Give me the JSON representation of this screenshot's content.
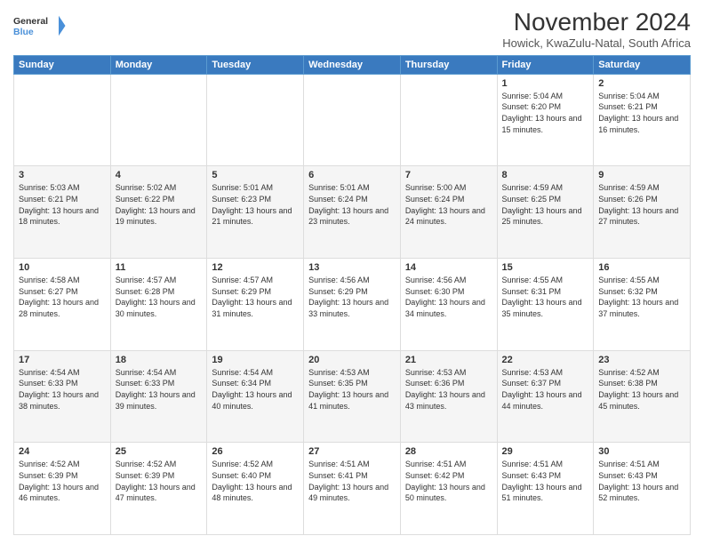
{
  "logo": {
    "line1": "General",
    "line2": "Blue"
  },
  "title": "November 2024",
  "subtitle": "Howick, KwaZulu-Natal, South Africa",
  "headers": [
    "Sunday",
    "Monday",
    "Tuesday",
    "Wednesday",
    "Thursday",
    "Friday",
    "Saturday"
  ],
  "weeks": [
    [
      {
        "day": "",
        "info": ""
      },
      {
        "day": "",
        "info": ""
      },
      {
        "day": "",
        "info": ""
      },
      {
        "day": "",
        "info": ""
      },
      {
        "day": "",
        "info": ""
      },
      {
        "day": "1",
        "info": "Sunrise: 5:04 AM\nSunset: 6:20 PM\nDaylight: 13 hours and 15 minutes."
      },
      {
        "day": "2",
        "info": "Sunrise: 5:04 AM\nSunset: 6:21 PM\nDaylight: 13 hours and 16 minutes."
      }
    ],
    [
      {
        "day": "3",
        "info": "Sunrise: 5:03 AM\nSunset: 6:21 PM\nDaylight: 13 hours and 18 minutes."
      },
      {
        "day": "4",
        "info": "Sunrise: 5:02 AM\nSunset: 6:22 PM\nDaylight: 13 hours and 19 minutes."
      },
      {
        "day": "5",
        "info": "Sunrise: 5:01 AM\nSunset: 6:23 PM\nDaylight: 13 hours and 21 minutes."
      },
      {
        "day": "6",
        "info": "Sunrise: 5:01 AM\nSunset: 6:24 PM\nDaylight: 13 hours and 23 minutes."
      },
      {
        "day": "7",
        "info": "Sunrise: 5:00 AM\nSunset: 6:24 PM\nDaylight: 13 hours and 24 minutes."
      },
      {
        "day": "8",
        "info": "Sunrise: 4:59 AM\nSunset: 6:25 PM\nDaylight: 13 hours and 25 minutes."
      },
      {
        "day": "9",
        "info": "Sunrise: 4:59 AM\nSunset: 6:26 PM\nDaylight: 13 hours and 27 minutes."
      }
    ],
    [
      {
        "day": "10",
        "info": "Sunrise: 4:58 AM\nSunset: 6:27 PM\nDaylight: 13 hours and 28 minutes."
      },
      {
        "day": "11",
        "info": "Sunrise: 4:57 AM\nSunset: 6:28 PM\nDaylight: 13 hours and 30 minutes."
      },
      {
        "day": "12",
        "info": "Sunrise: 4:57 AM\nSunset: 6:29 PM\nDaylight: 13 hours and 31 minutes."
      },
      {
        "day": "13",
        "info": "Sunrise: 4:56 AM\nSunset: 6:29 PM\nDaylight: 13 hours and 33 minutes."
      },
      {
        "day": "14",
        "info": "Sunrise: 4:56 AM\nSunset: 6:30 PM\nDaylight: 13 hours and 34 minutes."
      },
      {
        "day": "15",
        "info": "Sunrise: 4:55 AM\nSunset: 6:31 PM\nDaylight: 13 hours and 35 minutes."
      },
      {
        "day": "16",
        "info": "Sunrise: 4:55 AM\nSunset: 6:32 PM\nDaylight: 13 hours and 37 minutes."
      }
    ],
    [
      {
        "day": "17",
        "info": "Sunrise: 4:54 AM\nSunset: 6:33 PM\nDaylight: 13 hours and 38 minutes."
      },
      {
        "day": "18",
        "info": "Sunrise: 4:54 AM\nSunset: 6:33 PM\nDaylight: 13 hours and 39 minutes."
      },
      {
        "day": "19",
        "info": "Sunrise: 4:54 AM\nSunset: 6:34 PM\nDaylight: 13 hours and 40 minutes."
      },
      {
        "day": "20",
        "info": "Sunrise: 4:53 AM\nSunset: 6:35 PM\nDaylight: 13 hours and 41 minutes."
      },
      {
        "day": "21",
        "info": "Sunrise: 4:53 AM\nSunset: 6:36 PM\nDaylight: 13 hours and 43 minutes."
      },
      {
        "day": "22",
        "info": "Sunrise: 4:53 AM\nSunset: 6:37 PM\nDaylight: 13 hours and 44 minutes."
      },
      {
        "day": "23",
        "info": "Sunrise: 4:52 AM\nSunset: 6:38 PM\nDaylight: 13 hours and 45 minutes."
      }
    ],
    [
      {
        "day": "24",
        "info": "Sunrise: 4:52 AM\nSunset: 6:39 PM\nDaylight: 13 hours and 46 minutes."
      },
      {
        "day": "25",
        "info": "Sunrise: 4:52 AM\nSunset: 6:39 PM\nDaylight: 13 hours and 47 minutes."
      },
      {
        "day": "26",
        "info": "Sunrise: 4:52 AM\nSunset: 6:40 PM\nDaylight: 13 hours and 48 minutes."
      },
      {
        "day": "27",
        "info": "Sunrise: 4:51 AM\nSunset: 6:41 PM\nDaylight: 13 hours and 49 minutes."
      },
      {
        "day": "28",
        "info": "Sunrise: 4:51 AM\nSunset: 6:42 PM\nDaylight: 13 hours and 50 minutes."
      },
      {
        "day": "29",
        "info": "Sunrise: 4:51 AM\nSunset: 6:43 PM\nDaylight: 13 hours and 51 minutes."
      },
      {
        "day": "30",
        "info": "Sunrise: 4:51 AM\nSunset: 6:43 PM\nDaylight: 13 hours and 52 minutes."
      }
    ]
  ]
}
